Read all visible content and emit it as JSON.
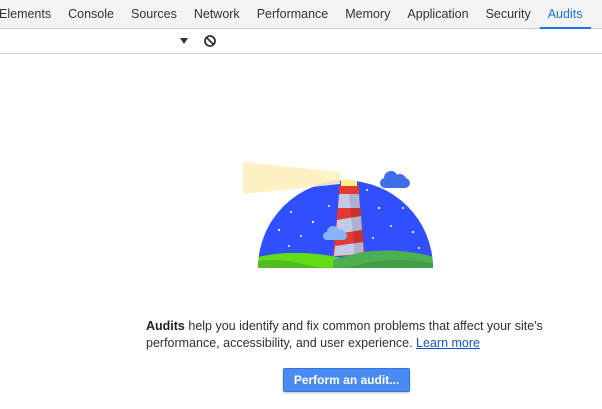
{
  "tabs": [
    {
      "label": "Elements",
      "active": false
    },
    {
      "label": "Console",
      "active": false
    },
    {
      "label": "Sources",
      "active": false
    },
    {
      "label": "Network",
      "active": false
    },
    {
      "label": "Performance",
      "active": false
    },
    {
      "label": "Memory",
      "active": false
    },
    {
      "label": "Application",
      "active": false
    },
    {
      "label": "Security",
      "active": false
    },
    {
      "label": "Audits",
      "active": true
    }
  ],
  "toolbar": {
    "dropdown_icon": "dropdown-arrow",
    "clear_icon": "clear-circle-slash"
  },
  "main": {
    "illustration": "lighthouse-logo",
    "description_strong": "Audits",
    "description_rest": " help you identify and fix common problems that affect your site's performance, accessibility, and user experience. ",
    "learn_more": "Learn more",
    "button_label": "Perform an audit..."
  },
  "colors": {
    "accent": "#1a73e8",
    "button": "#4a8af4",
    "link": "#1155cc",
    "sky": "#304ffe",
    "hill": "#64dd17"
  }
}
